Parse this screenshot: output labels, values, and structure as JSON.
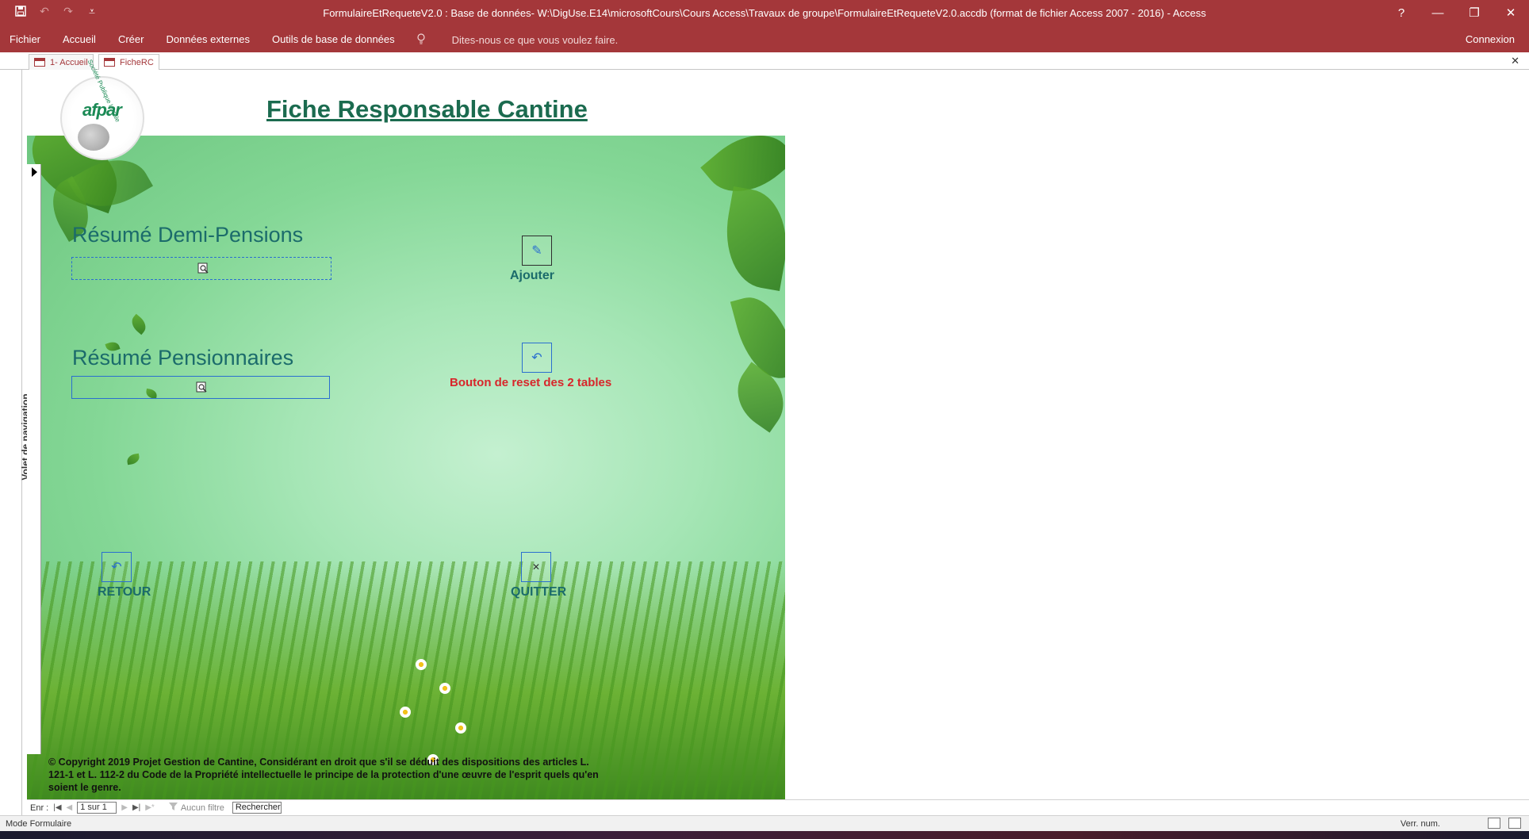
{
  "window": {
    "title": "FormulaireEtRequeteV2.0 : Base de données- W:\\DigUse.E14\\microsoftCours\\Cours Access\\Travaux de groupe\\FormulaireEtRequeteV2.0.accdb (format de fichier Access 2007 - 2016) - Access",
    "help": "?",
    "minimize": "—",
    "restore": "❐",
    "close": "✕"
  },
  "ribbon": {
    "tabs": [
      "Fichier",
      "Accueil",
      "Créer",
      "Données externes",
      "Outils de base de données"
    ],
    "tell_me": "Dites-nous ce que vous voulez faire.",
    "connexion": "Connexion"
  },
  "nav_pane": {
    "label": "Volet de navigation",
    "toggle": "»"
  },
  "doc_tabs": [
    {
      "label": "1- Accueil",
      "active": false
    },
    {
      "label": "FicheRC",
      "active": true
    }
  ],
  "doc_close": "✕",
  "form": {
    "logo_text": "afpar",
    "logo_ring": "Société Publique Locale",
    "title": "Fiche Responsable Cantine",
    "sections": {
      "demi_pensions": "Résumé Demi-Pensions",
      "pensionnaires": "Résumé Pensionnaires"
    },
    "buttons": {
      "ajouter_icon": "✎",
      "ajouter_label": "Ajouter",
      "reset_icon": "↶",
      "reset_label": "Bouton de reset des 2 tables",
      "retour_icon": "↶",
      "retour_label": "RETOUR",
      "quitter_icon": "✕",
      "quitter_label": "QUITTER"
    },
    "copyright": "© Copyright 2019 Projet Gestion de Cantine, Considérant en droit que s'il se déduit des dispositions des articles L. 121-1 et L. 112-2 du Code de la Propriété intellectuelle le principe de la protection d'une œuvre de l'esprit quels qu'en soient le genre."
  },
  "record_nav": {
    "label": "Enr :",
    "position": "1 sur 1",
    "filter": "Aucun filtre",
    "search": "Rechercher"
  },
  "status": {
    "mode": "Mode Formulaire",
    "numlock": "Verr. num."
  },
  "colors": {
    "access_red": "#a4373a",
    "title_green": "#1b6b4f",
    "reset_red": "#d8262b",
    "control_blue": "#2a6fcf"
  }
}
